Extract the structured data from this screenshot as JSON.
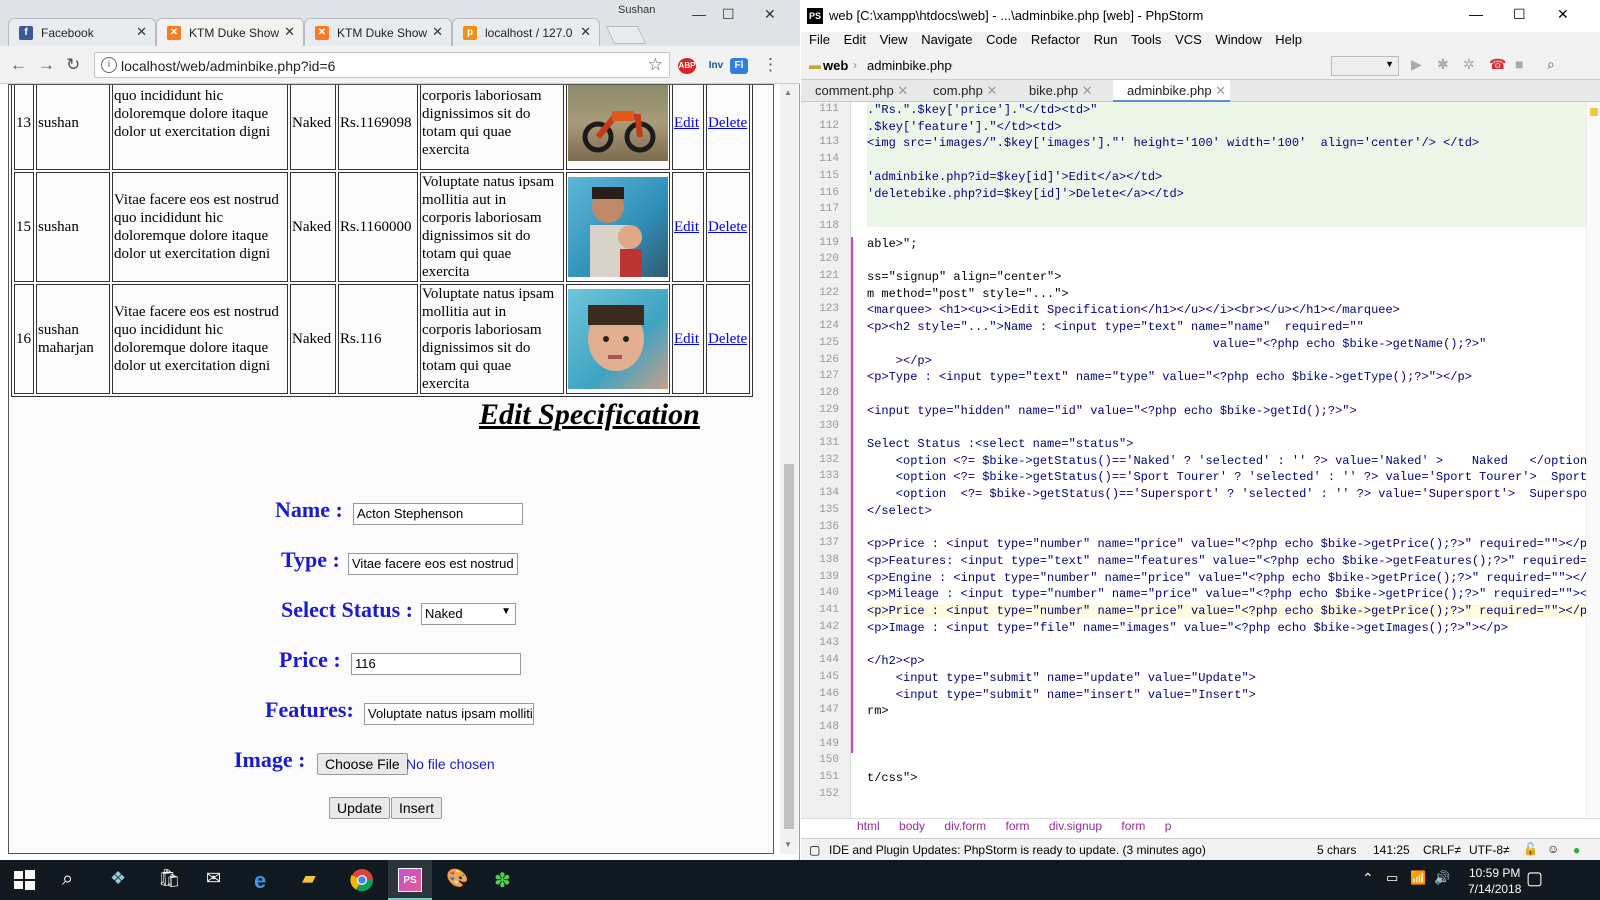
{
  "browser": {
    "tabs": [
      {
        "title": "Facebook",
        "icon": "facebook-icon",
        "color": "#3b5998"
      },
      {
        "title": "KTM Duke Show",
        "icon": "xampp-icon",
        "color": "#fb7a24"
      },
      {
        "title": "KTM Duke Show",
        "icon": "xampp-icon",
        "color": "#fb7a24"
      },
      {
        "title": "localhost / 127.0",
        "icon": "phpmyadmin-icon",
        "color": "#f29111"
      }
    ],
    "profile": "Sushan",
    "url": "localhost/web/adminbike.php?id=6",
    "extensions": [
      "ABP",
      "Inv",
      "Fl"
    ]
  },
  "table": {
    "rows": [
      {
        "id": "13",
        "name": "sushan",
        "desc": [
          "quo incididunt hic",
          "doloremque dolore itaque",
          "dolor ut exercitation digni"
        ],
        "status": "Naked",
        "price": "Rs.1169098",
        "features": [
          "corporis laboriosam",
          "dignissimos sit do",
          "totam qui quae",
          "exercita"
        ],
        "edit": "Edit",
        "delete": "Delete"
      },
      {
        "id": "15",
        "name": "sushan",
        "desc": [
          "Vitae facere eos est nostrud",
          "quo incididunt hic",
          "doloremque dolore itaque",
          "dolor ut exercitation digni"
        ],
        "status": "Naked",
        "price": "Rs.1160000",
        "features": [
          "Voluptate natus ipsam",
          "mollitia aut in",
          "corporis laboriosam",
          "dignissimos sit do",
          "totam qui quae",
          "exercita"
        ],
        "edit": "Edit",
        "delete": "Delete"
      },
      {
        "id": "16",
        "name": "sushan maharjan",
        "desc": [
          "Vitae facere eos est nostrud",
          "quo incididunt hic",
          "doloremque dolore itaque",
          "dolor ut exercitation digni"
        ],
        "status": "Naked",
        "price": "Rs.116",
        "features": [
          "Voluptate natus ipsam",
          "mollitia aut in",
          "corporis laboriosam",
          "dignissimos sit do",
          "totam qui quae",
          "exercita"
        ],
        "edit": "Edit",
        "delete": "Delete"
      }
    ]
  },
  "form": {
    "title": "Edit Specification",
    "name_label": "Name :",
    "name_value": "Acton Stephenson",
    "type_label": "Type :",
    "type_value": "Vitae facere eos est nostrud",
    "status_label": "Select Status :",
    "status_value": "Naked",
    "price_label": "Price :",
    "price_value": "116",
    "features_label": "Features:",
    "features_value": "Voluptate natus ipsam molliti",
    "image_label": "Image :",
    "choose_file": "Choose File",
    "no_file": "No file chosen",
    "update": "Update",
    "insert": "Insert"
  },
  "ide": {
    "title": "web [C:\\xampp\\htdocs\\web] - ...\\adminbike.php [web] - PhpStorm",
    "menu": [
      "File",
      "Edit",
      "View",
      "Navigate",
      "Code",
      "Refactor",
      "Run",
      "Tools",
      "VCS",
      "Window",
      "Help"
    ],
    "nav_project": "web",
    "nav_file": "adminbike.php",
    "tabs": [
      "comment.php",
      "com.php",
      "bike.php",
      "adminbike.php"
    ],
    "active_tab": "adminbike.php",
    "lines": [
      {
        "n": "111",
        "t": ".\"Rs.\".$key['price'].\"</td><td>\""
      },
      {
        "n": "112",
        "t": ".$key['feature'].\"</td><td>"
      },
      {
        "n": "113",
        "t": "<img src='images/\".$key['images'].\"' height='100' width='100'  align='center'/> </td>"
      },
      {
        "n": "114",
        "t": ""
      },
      {
        "n": "115",
        "t": "'adminbike.php?id=$key[id]'>Edit</a></td>"
      },
      {
        "n": "116",
        "t": "'deletebike.php?id=$key[id]'>Delete</a></td>"
      },
      {
        "n": "117",
        "t": ""
      },
      {
        "n": "118",
        "t": ""
      },
      {
        "n": "119",
        "t": "able>\";"
      },
      {
        "n": "120",
        "t": ""
      },
      {
        "n": "121",
        "t": "ss=\"signup\" align=\"center\">"
      },
      {
        "n": "122",
        "t": "m method=\"post\" style=\"...\">"
      },
      {
        "n": "123",
        "t": "<marquee> <h1><u><i>Edit Specification</h1></u></i><br></u></h1></marquee>"
      },
      {
        "n": "124",
        "t": "<p><h2 style=\"...\">Name : <input type=\"text\" name=\"name\"  required=\"\""
      },
      {
        "n": "125",
        "t": "                                                value=\"<?php echo $bike->getName();?>\""
      },
      {
        "n": "126",
        "t": "    ></p>"
      },
      {
        "n": "127",
        "t": "<p>Type : <input type=\"text\" name=\"type\" value=\"<?php echo $bike->getType();?>\"></p>"
      },
      {
        "n": "128",
        "t": ""
      },
      {
        "n": "129",
        "t": "<input type=\"hidden\" name=\"id\" value=\"<?php echo $bike->getId();?>\">"
      },
      {
        "n": "130",
        "t": ""
      },
      {
        "n": "131",
        "t": "Select Status :<select name=\"status\">"
      },
      {
        "n": "132",
        "t": "    <option <?= $bike->getStatus()=='Naked' ? 'selected' : '' ?> value='Naked' >    Naked   </option>"
      },
      {
        "n": "133",
        "t": "    <option <?= $bike->getStatus()=='Sport Tourer' ? 'selected' : '' ?> value='Sport Tourer'>  Sport Tou"
      },
      {
        "n": "134",
        "t": "    <option  <?= $bike->getStatus()=='Supersport' ? 'selected' : '' ?> value='Supersport'>  Supersport</"
      },
      {
        "n": "135",
        "t": "</select>"
      },
      {
        "n": "136",
        "t": ""
      },
      {
        "n": "137",
        "t": "<p>Price : <input type=\"number\" name=\"price\" value=\"<?php echo $bike->getPrice();?>\" required=\"\"></p>"
      },
      {
        "n": "138",
        "t": "<p>Features: <input type=\"text\" name=\"features\" value=\"<?php echo $bike->getFeatures();?>\" required=\"\""
      },
      {
        "n": "139",
        "t": "<p>Engine : <input type=\"number\" name=\"price\" value=\"<?php echo $bike->getPrice();?>\" required=\"\"></p>"
      },
      {
        "n": "140",
        "t": "<p>Mileage : <input type=\"number\" name=\"price\" value=\"<?php echo $bike->getPrice();?>\" required=\"\"></p>"
      },
      {
        "n": "141",
        "t": "<p>Price : <input type=\"number\" name=\"price\" value=\"<?php echo $bike->getPrice();?>\" required=\"\"></p>"
      },
      {
        "n": "142",
        "t": "<p>Image : <input type=\"file\" name=\"images\" value=\"<?php echo $bike->getImages();?>\"></p>"
      },
      {
        "n": "143",
        "t": ""
      },
      {
        "n": "144",
        "t": "</h2><p>"
      },
      {
        "n": "145",
        "t": "    <input type=\"submit\" name=\"update\" value=\"Update\">"
      },
      {
        "n": "146",
        "t": "    <input type=\"submit\" name=\"insert\" value=\"Insert\">"
      },
      {
        "n": "147",
        "t": "rm>"
      },
      {
        "n": "148",
        "t": ""
      },
      {
        "n": "149",
        "t": ""
      },
      {
        "n": "150",
        "t": ""
      },
      {
        "n": "151",
        "t": "t/css\">"
      },
      {
        "n": "152",
        "t": ""
      }
    ],
    "breadcrumbs": [
      "html",
      "body",
      "div.form",
      "form",
      "div.signup",
      "form",
      "p"
    ],
    "status_msg": "IDE and Plugin Updates: PhpStorm is ready to update. (3 minutes ago)",
    "chars": "5 chars",
    "position": "141:25",
    "line_sep": "CRLF≠",
    "encoding": "UTF-8≠"
  },
  "taskbar": {
    "time": "10:59 PM",
    "date": "7/14/2018"
  }
}
